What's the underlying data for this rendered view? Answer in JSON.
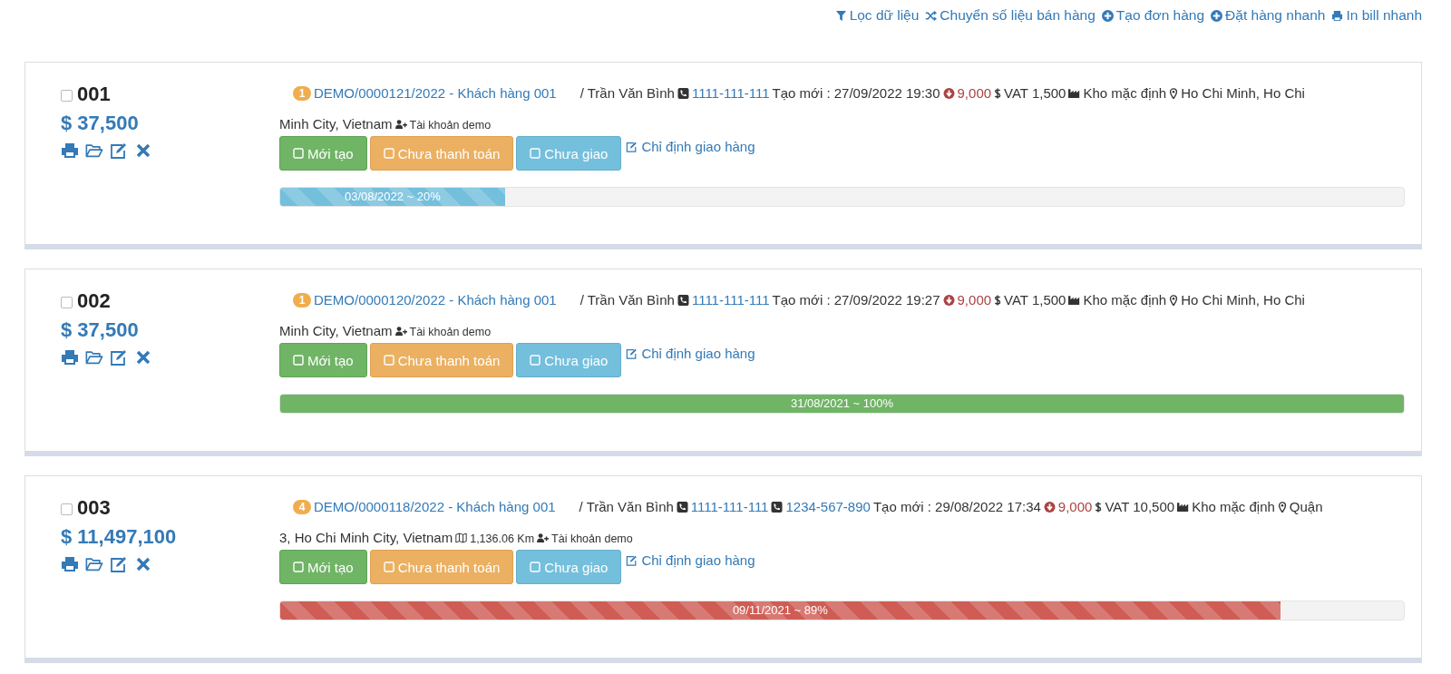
{
  "toolbar": [
    {
      "kind": "filter",
      "label": "Lọc dữ liệu"
    },
    {
      "kind": "shuffle",
      "label": "Chuyển số liệu bán hàng"
    },
    {
      "kind": "plus",
      "label": "Tạo đơn hàng"
    },
    {
      "kind": "plus",
      "label": "Đặt hàng nhanh"
    },
    {
      "kind": "print",
      "label": "In bill nhanh"
    }
  ],
  "orders": [
    {
      "number": "001",
      "checked": false,
      "amount": "$ 37,500",
      "badge": "1",
      "order_link": "DEMO/0000121/2022 - Khách hàng 001",
      "customer": "/ Trần Văn Bình",
      "phones": [
        "1111-111-111"
      ],
      "created": "Tạo mới : 27/09/2022 19:30",
      "discount": "9,000",
      "vat": "VAT 1,500",
      "warehouse": "Kho mặc định",
      "address": [
        "Ho Chi Minh, Ho Chi",
        "Minh City, Vietnam"
      ],
      "account": "Tài khoản demo",
      "statuses": [
        {
          "kind": "success",
          "label": "Mới tạo"
        },
        {
          "kind": "warning",
          "label": "Chưa thanh toán"
        },
        {
          "kind": "info",
          "label": "Chưa giao"
        }
      ],
      "assign": "Chỉ định giao hàng",
      "progress": {
        "kind": "info",
        "striped": true,
        "level": 0.2,
        "label": "03/08/2022 ~ 20%"
      }
    },
    {
      "number": "002",
      "checked": false,
      "amount": "$ 37,500",
      "badge": "1",
      "order_link": "DEMO/0000120/2022 - Khách hàng 001",
      "customer": "/ Trần Văn Bình",
      "phones": [
        "1111-111-111"
      ],
      "created": "Tạo mới : 27/09/2022 19:27",
      "discount": "9,000",
      "vat": "VAT 1,500",
      "warehouse": "Kho mặc định",
      "address": [
        "Ho Chi Minh, Ho Chi",
        "Minh City, Vietnam"
      ],
      "account": "Tài khoản demo",
      "statuses": [
        {
          "kind": "success",
          "label": "Mới tạo"
        },
        {
          "kind": "warning",
          "label": "Chưa thanh toán"
        },
        {
          "kind": "info",
          "label": "Chưa giao"
        }
      ],
      "assign": "Chỉ định giao hàng",
      "progress": {
        "kind": "success",
        "striped": false,
        "level": 1,
        "label": "31/08/2021 ~ 100%"
      }
    },
    {
      "number": "003",
      "checked": false,
      "amount": "$ 11,497,100",
      "badge": "4",
      "order_link": "DEMO/0000118/2022 - Khách hàng 001",
      "customer": "/ Trần Văn Bình",
      "phones": [
        "1111-111-111",
        "1234-567-890"
      ],
      "created": "Tạo mới : 29/08/2022 17:34",
      "discount": "9,000",
      "vat": "VAT 10,500",
      "warehouse": "Kho mặc định",
      "address": [
        "Quận",
        "3, Ho Chi Minh City, Vietnam"
      ],
      "distance": "1,136.06 Km",
      "account": "Tài khoản demo",
      "statuses": [
        {
          "kind": "success",
          "label": "Mới tạo"
        },
        {
          "kind": "warning",
          "label": "Chưa thanh toán"
        },
        {
          "kind": "info",
          "label": "Chưa giao"
        }
      ],
      "assign": "Chỉ định giao hàng",
      "progress": {
        "kind": "danger",
        "striped": true,
        "level": 0.89,
        "label": "09/11/2021 ~ 89%"
      }
    }
  ]
}
